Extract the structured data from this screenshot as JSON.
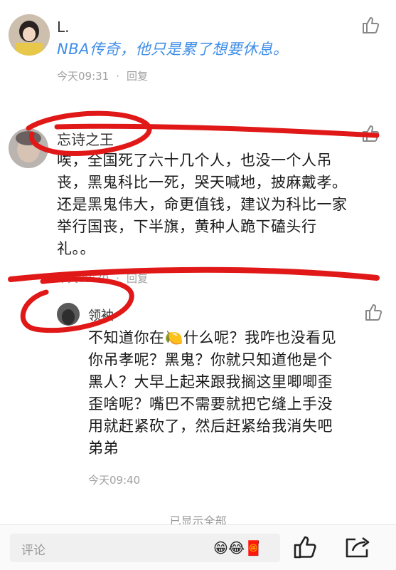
{
  "comments": [
    {
      "username": "L.",
      "text": "NBA传奇，他只是累了想要休息。",
      "time": "今天09:31",
      "reply_label": "回复"
    },
    {
      "username": "忘诗之王",
      "text_lines": [
        "唉，全国死了六十几个人，也没一个人吊",
        "丧，黑鬼科比一死，哭天喊地，披麻戴孝。",
        "还是黑鬼伟大，命更值钱，建议为科比一家",
        "举行国丧，下半旗，黄种人跪下磕头行",
        "礼。。"
      ],
      "time": "今天09:30",
      "reply_label": "回复"
    },
    {
      "username": "领袖",
      "text_lines": [
        "不知道你在🍋什么呢？我咋也没看见",
        "你吊孝呢？黑鬼？你就只知道他是个",
        "黑人？大早上起来跟我搁这里唧唧歪",
        "歪啥呢？嘴巴不需要就把它缝上手没",
        "用就赶紧砍了，然后赶紧给我消失吧",
        "弟弟"
      ],
      "time": "今天09:40"
    }
  ],
  "footer": {
    "show_all": "已显示全部",
    "comment_placeholder": "评论",
    "emojis": "😁😂🧧"
  },
  "colors": {
    "link_blue": "#3f8ee8",
    "meta_gray": "#a0a0a0",
    "scribble_red": "#e01818"
  }
}
